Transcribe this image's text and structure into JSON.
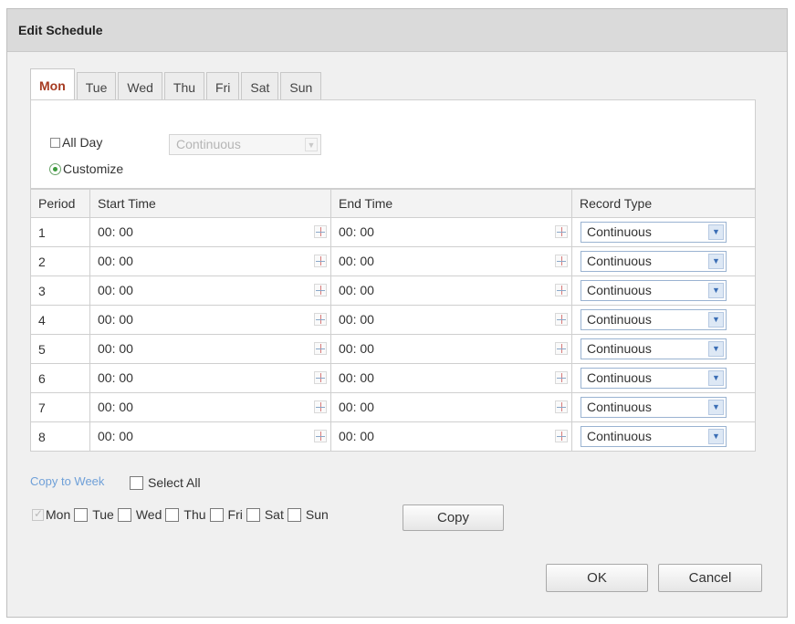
{
  "dialog": {
    "title": "Edit Schedule"
  },
  "tabs": [
    {
      "label": "Mon",
      "active": true
    },
    {
      "label": "Tue",
      "active": false
    },
    {
      "label": "Wed",
      "active": false
    },
    {
      "label": "Thu",
      "active": false
    },
    {
      "label": "Fri",
      "active": false
    },
    {
      "label": "Sat",
      "active": false
    },
    {
      "label": "Sun",
      "active": false
    }
  ],
  "options": {
    "all_day_label": "All Day",
    "all_day_checked": false,
    "all_day_type": "Continuous",
    "customize_label": "Customize",
    "customize_selected": true
  },
  "table": {
    "headers": {
      "period": "Period",
      "start": "Start Time",
      "end": "End Time",
      "type": "Record Type"
    },
    "rows": [
      {
        "period": "1",
        "start": "00: 00",
        "end": "00: 00",
        "type": "Continuous"
      },
      {
        "period": "2",
        "start": "00: 00",
        "end": "00: 00",
        "type": "Continuous"
      },
      {
        "period": "3",
        "start": "00: 00",
        "end": "00: 00",
        "type": "Continuous"
      },
      {
        "period": "4",
        "start": "00: 00",
        "end": "00: 00",
        "type": "Continuous"
      },
      {
        "period": "5",
        "start": "00: 00",
        "end": "00: 00",
        "type": "Continuous"
      },
      {
        "period": "6",
        "start": "00: 00",
        "end": "00: 00",
        "type": "Continuous"
      },
      {
        "period": "7",
        "start": "00: 00",
        "end": "00: 00",
        "type": "Continuous"
      },
      {
        "period": "8",
        "start": "00: 00",
        "end": "00: 00",
        "type": "Continuous"
      }
    ]
  },
  "copy": {
    "link_label": "Copy to Week",
    "select_all_label": "Select All",
    "days": [
      {
        "label": "Mon",
        "checked": true
      },
      {
        "label": "Tue",
        "checked": false
      },
      {
        "label": "Wed",
        "checked": false
      },
      {
        "label": "Thu",
        "checked": false
      },
      {
        "label": "Fri",
        "checked": false
      },
      {
        "label": "Sat",
        "checked": false
      },
      {
        "label": "Sun",
        "checked": false
      }
    ],
    "copy_button": "Copy"
  },
  "footer": {
    "ok": "OK",
    "cancel": "Cancel"
  },
  "colors": {
    "active_tab": "#a63b21",
    "link": "#6fa0d8",
    "select_border": "#9ab3d1"
  },
  "icons": {
    "time_picker": "clock-icon",
    "dropdown": "chevron-down-icon"
  }
}
